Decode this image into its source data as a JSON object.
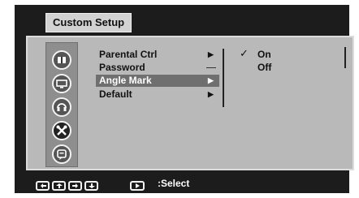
{
  "title": "Custom Setup",
  "categories": [
    {
      "icon": "disc-icon"
    },
    {
      "icon": "display-icon"
    },
    {
      "icon": "audio-icon"
    },
    {
      "icon": "tools-icon",
      "selected": true
    },
    {
      "icon": "language-icon"
    }
  ],
  "menu": [
    {
      "label": "Parental Ctrl",
      "indicator": "arrow"
    },
    {
      "label": "Password",
      "indicator": "dash"
    },
    {
      "label": "Angle Mark",
      "indicator": "arrow",
      "highlighted": true
    },
    {
      "label": "Default",
      "indicator": "arrow"
    }
  ],
  "submenu": {
    "options": [
      "On",
      "Off"
    ],
    "checked": "On",
    "check_symbol": "✓"
  },
  "footer": {
    "nav_icons": [
      "left-arrow-icon",
      "up-arrow-icon",
      "right-arrow-icon",
      "down-arrow-icon"
    ],
    "enter_icon": "enter-icon",
    "select_label": ":Select"
  },
  "colors": {
    "frame": "#1c1c1c",
    "panel": "#b9b9b9",
    "highlight": "#6f6f6f",
    "text": "#111111"
  }
}
